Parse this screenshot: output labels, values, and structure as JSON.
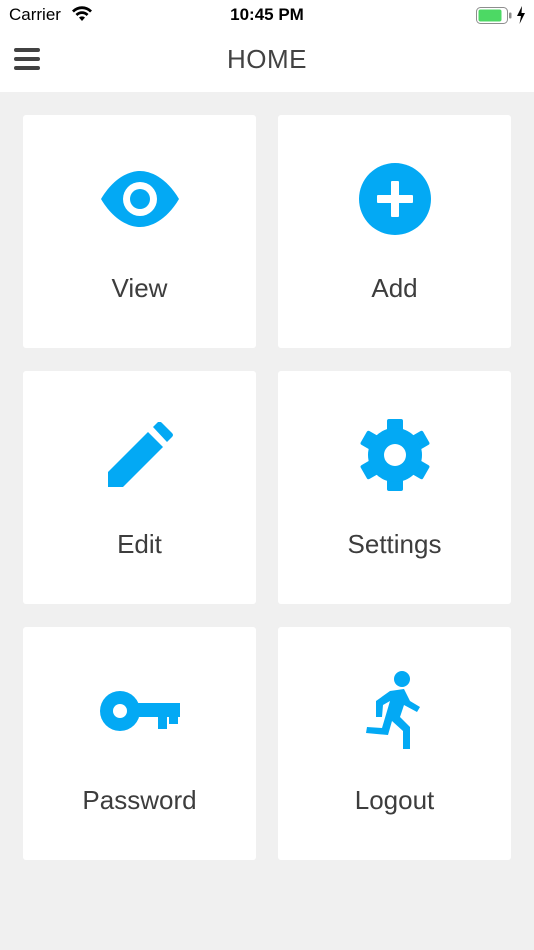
{
  "status_bar": {
    "carrier": "Carrier",
    "time": "10:45 PM",
    "wifi_icon": "wifi-icon",
    "battery_icon": "battery-icon",
    "charging_icon": "charging-bolt-icon"
  },
  "nav": {
    "title": "HOME",
    "menu_icon": "hamburger-menu-icon"
  },
  "colors": {
    "accent": "#03a9f4",
    "background": "#f0f0f0",
    "tile": "#ffffff",
    "text": "#3d3d3d",
    "battery": "#4cd964"
  },
  "tiles": [
    {
      "label": "View",
      "icon": "eye-icon"
    },
    {
      "label": "Add",
      "icon": "add-circle-icon"
    },
    {
      "label": "Edit",
      "icon": "pencil-icon"
    },
    {
      "label": "Settings",
      "icon": "gear-icon"
    },
    {
      "label": "Password",
      "icon": "key-icon"
    },
    {
      "label": "Logout",
      "icon": "running-person-icon"
    }
  ]
}
